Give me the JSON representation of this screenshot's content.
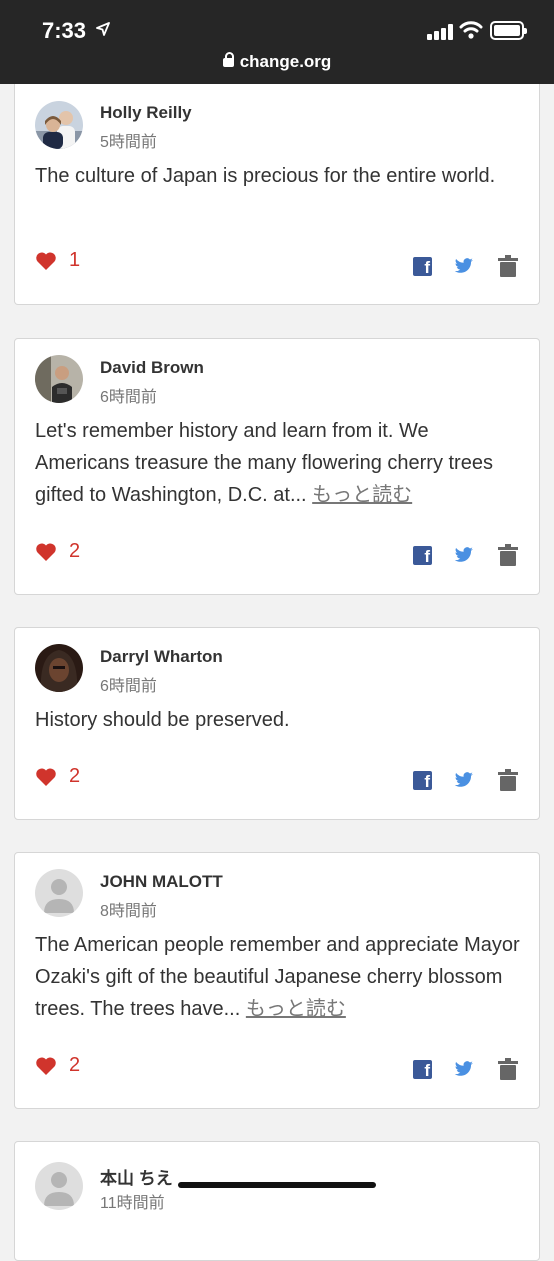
{
  "status_bar": {
    "time": "7:33",
    "url": "change.org"
  },
  "comments": [
    {
      "name": "Holly Reilly",
      "time_ago": "5時間前",
      "text": "The culture of Japan is precious for the entire world.",
      "more_label": "",
      "likes": "1",
      "avatar": "photo-couple"
    },
    {
      "name": "David Brown",
      "time_ago": "6時間前",
      "text": "Let's remember history and learn from it. We Americans treasure the many flowering cherry trees gifted to Washington, D.C. at... ",
      "more_label": "もっと読む",
      "likes": "2",
      "avatar": "photo-man"
    },
    {
      "name": "Darryl Wharton",
      "time_ago": "6時間前",
      "text": "History should be preserved.",
      "more_label": "",
      "likes": "2",
      "avatar": "photo-hood"
    },
    {
      "name": "JOHN MALOTT",
      "time_ago": "8時間前",
      "text": "The American people remember and appreciate Mayor Ozaki's gift of the beautiful Japanese cherry blossom trees. The trees have... ",
      "more_label": "もっと読む",
      "likes": "2",
      "avatar": "default-user"
    },
    {
      "name": "本山 ちえ",
      "time_ago": "11時間前",
      "text": "",
      "more_label": "",
      "likes": "",
      "avatar": "default-user"
    }
  ],
  "colors": {
    "heart": "#d0342c",
    "facebook": "#3b5998",
    "twitter": "#4a90e2",
    "trash": "#666666"
  }
}
